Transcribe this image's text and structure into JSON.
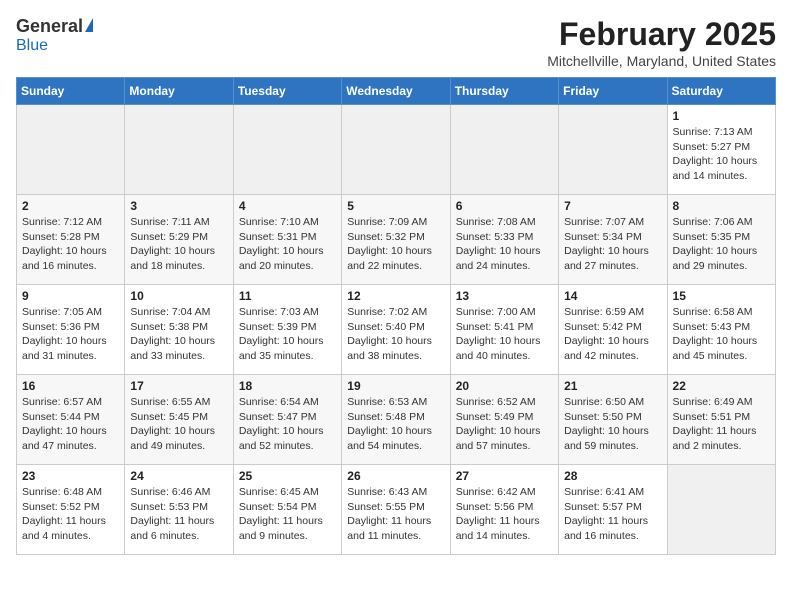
{
  "logo": {
    "general": "General",
    "blue": "Blue"
  },
  "header": {
    "title": "February 2025",
    "subtitle": "Mitchellville, Maryland, United States"
  },
  "weekdays": [
    "Sunday",
    "Monday",
    "Tuesday",
    "Wednesday",
    "Thursday",
    "Friday",
    "Saturday"
  ],
  "weeks": [
    [
      {
        "day": "",
        "info": ""
      },
      {
        "day": "",
        "info": ""
      },
      {
        "day": "",
        "info": ""
      },
      {
        "day": "",
        "info": ""
      },
      {
        "day": "",
        "info": ""
      },
      {
        "day": "",
        "info": ""
      },
      {
        "day": "1",
        "info": "Sunrise: 7:13 AM\nSunset: 5:27 PM\nDaylight: 10 hours and 14 minutes."
      }
    ],
    [
      {
        "day": "2",
        "info": "Sunrise: 7:12 AM\nSunset: 5:28 PM\nDaylight: 10 hours and 16 minutes."
      },
      {
        "day": "3",
        "info": "Sunrise: 7:11 AM\nSunset: 5:29 PM\nDaylight: 10 hours and 18 minutes."
      },
      {
        "day": "4",
        "info": "Sunrise: 7:10 AM\nSunset: 5:31 PM\nDaylight: 10 hours and 20 minutes."
      },
      {
        "day": "5",
        "info": "Sunrise: 7:09 AM\nSunset: 5:32 PM\nDaylight: 10 hours and 22 minutes."
      },
      {
        "day": "6",
        "info": "Sunrise: 7:08 AM\nSunset: 5:33 PM\nDaylight: 10 hours and 24 minutes."
      },
      {
        "day": "7",
        "info": "Sunrise: 7:07 AM\nSunset: 5:34 PM\nDaylight: 10 hours and 27 minutes."
      },
      {
        "day": "8",
        "info": "Sunrise: 7:06 AM\nSunset: 5:35 PM\nDaylight: 10 hours and 29 minutes."
      }
    ],
    [
      {
        "day": "9",
        "info": "Sunrise: 7:05 AM\nSunset: 5:36 PM\nDaylight: 10 hours and 31 minutes."
      },
      {
        "day": "10",
        "info": "Sunrise: 7:04 AM\nSunset: 5:38 PM\nDaylight: 10 hours and 33 minutes."
      },
      {
        "day": "11",
        "info": "Sunrise: 7:03 AM\nSunset: 5:39 PM\nDaylight: 10 hours and 35 minutes."
      },
      {
        "day": "12",
        "info": "Sunrise: 7:02 AM\nSunset: 5:40 PM\nDaylight: 10 hours and 38 minutes."
      },
      {
        "day": "13",
        "info": "Sunrise: 7:00 AM\nSunset: 5:41 PM\nDaylight: 10 hours and 40 minutes."
      },
      {
        "day": "14",
        "info": "Sunrise: 6:59 AM\nSunset: 5:42 PM\nDaylight: 10 hours and 42 minutes."
      },
      {
        "day": "15",
        "info": "Sunrise: 6:58 AM\nSunset: 5:43 PM\nDaylight: 10 hours and 45 minutes."
      }
    ],
    [
      {
        "day": "16",
        "info": "Sunrise: 6:57 AM\nSunset: 5:44 PM\nDaylight: 10 hours and 47 minutes."
      },
      {
        "day": "17",
        "info": "Sunrise: 6:55 AM\nSunset: 5:45 PM\nDaylight: 10 hours and 49 minutes."
      },
      {
        "day": "18",
        "info": "Sunrise: 6:54 AM\nSunset: 5:47 PM\nDaylight: 10 hours and 52 minutes."
      },
      {
        "day": "19",
        "info": "Sunrise: 6:53 AM\nSunset: 5:48 PM\nDaylight: 10 hours and 54 minutes."
      },
      {
        "day": "20",
        "info": "Sunrise: 6:52 AM\nSunset: 5:49 PM\nDaylight: 10 hours and 57 minutes."
      },
      {
        "day": "21",
        "info": "Sunrise: 6:50 AM\nSunset: 5:50 PM\nDaylight: 10 hours and 59 minutes."
      },
      {
        "day": "22",
        "info": "Sunrise: 6:49 AM\nSunset: 5:51 PM\nDaylight: 11 hours and 2 minutes."
      }
    ],
    [
      {
        "day": "23",
        "info": "Sunrise: 6:48 AM\nSunset: 5:52 PM\nDaylight: 11 hours and 4 minutes."
      },
      {
        "day": "24",
        "info": "Sunrise: 6:46 AM\nSunset: 5:53 PM\nDaylight: 11 hours and 6 minutes."
      },
      {
        "day": "25",
        "info": "Sunrise: 6:45 AM\nSunset: 5:54 PM\nDaylight: 11 hours and 9 minutes."
      },
      {
        "day": "26",
        "info": "Sunrise: 6:43 AM\nSunset: 5:55 PM\nDaylight: 11 hours and 11 minutes."
      },
      {
        "day": "27",
        "info": "Sunrise: 6:42 AM\nSunset: 5:56 PM\nDaylight: 11 hours and 14 minutes."
      },
      {
        "day": "28",
        "info": "Sunrise: 6:41 AM\nSunset: 5:57 PM\nDaylight: 11 hours and 16 minutes."
      },
      {
        "day": "",
        "info": ""
      }
    ]
  ]
}
